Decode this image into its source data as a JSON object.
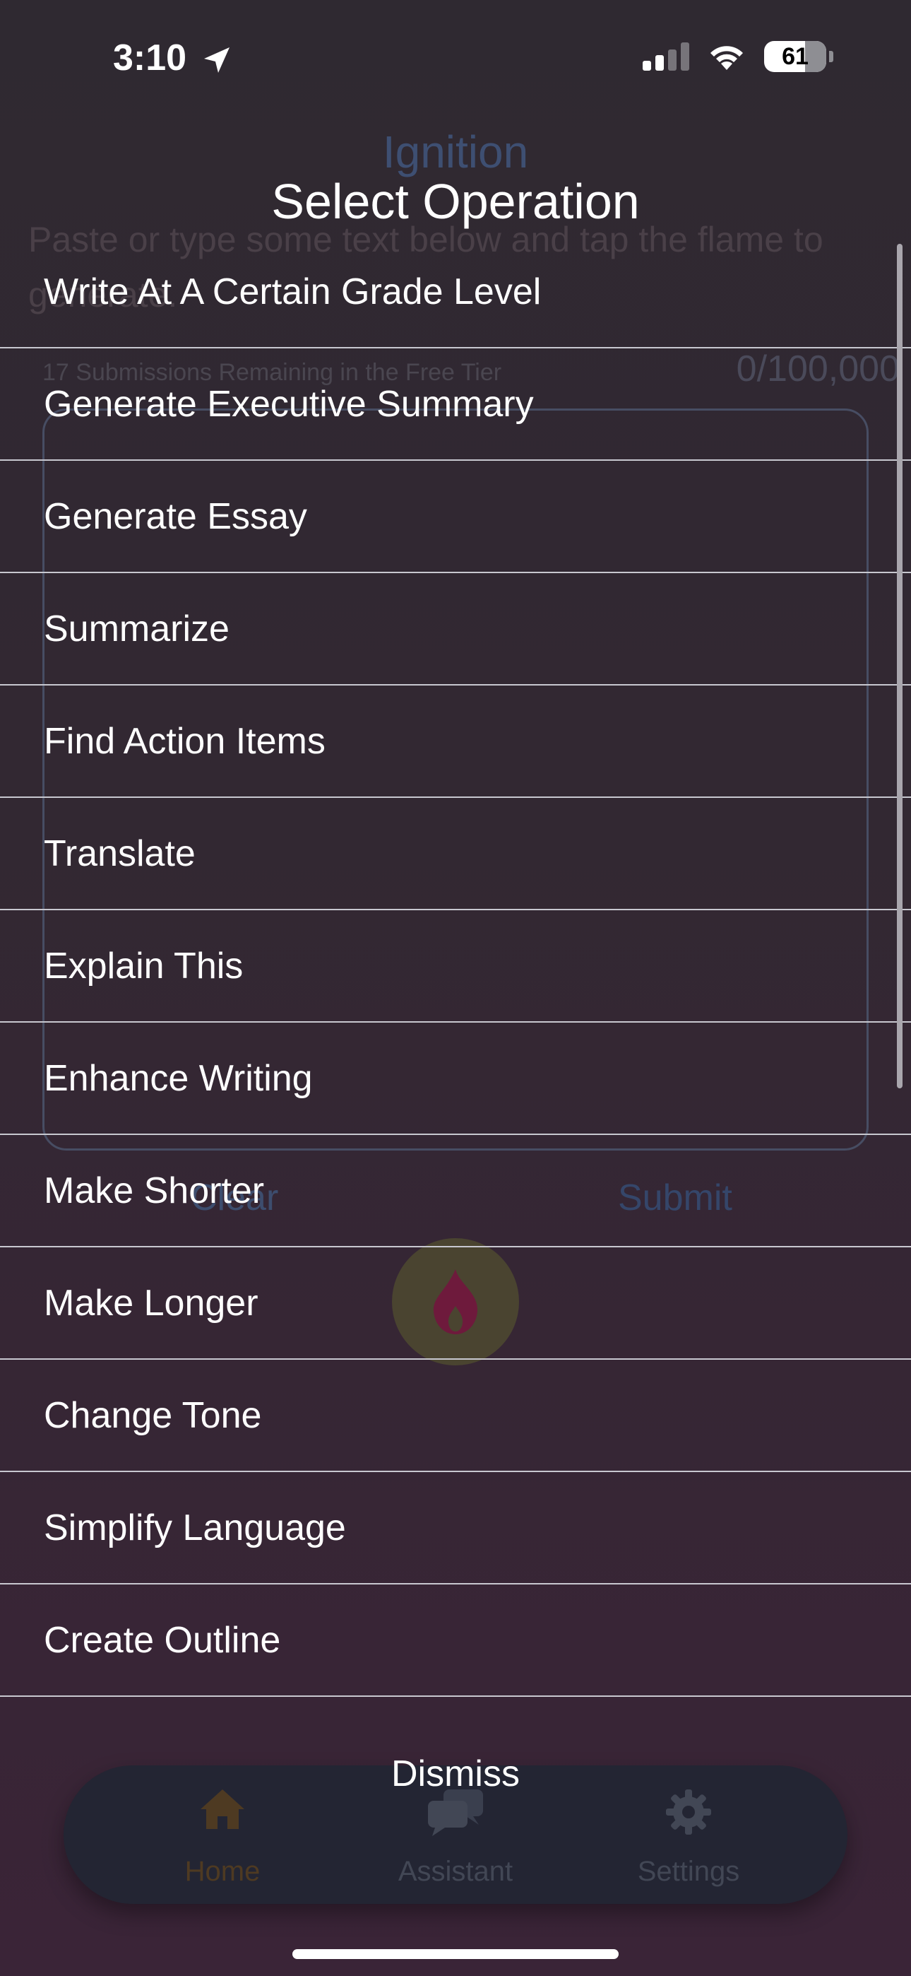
{
  "status_bar": {
    "time": "3:10",
    "battery": "61"
  },
  "background_app": {
    "title": "Ignition",
    "description": "Paste or type some text below and tap the flame to generate.",
    "submissions_remaining": "17 Submissions Remaining in the Free Tier",
    "char_count": "0/100,000",
    "clear_label": "Clear",
    "submit_label": "Submit",
    "tabs": [
      {
        "label": "Home",
        "icon": "house-icon"
      },
      {
        "label": "Assistant",
        "icon": "chat-bubbles-icon"
      },
      {
        "label": "Settings",
        "icon": "gear-icon"
      }
    ]
  },
  "sheet": {
    "title": "Select Operation",
    "operations": [
      "Write At A Certain Grade Level",
      "Generate Executive Summary",
      "Generate Essay",
      "Summarize",
      "Find Action Items",
      "Translate",
      "Explain This",
      "Enhance Writing",
      "Make Shorter",
      "Make Longer",
      "Change Tone",
      "Simplify Language",
      "Create Outline"
    ],
    "dismiss_label": "Dismiss"
  },
  "colors": {
    "background": "#322832",
    "divider": "#c8c8d0",
    "flame": "#6e1a3c",
    "flame_circle": "#4a4430",
    "home_tab": "#4e3a22"
  }
}
